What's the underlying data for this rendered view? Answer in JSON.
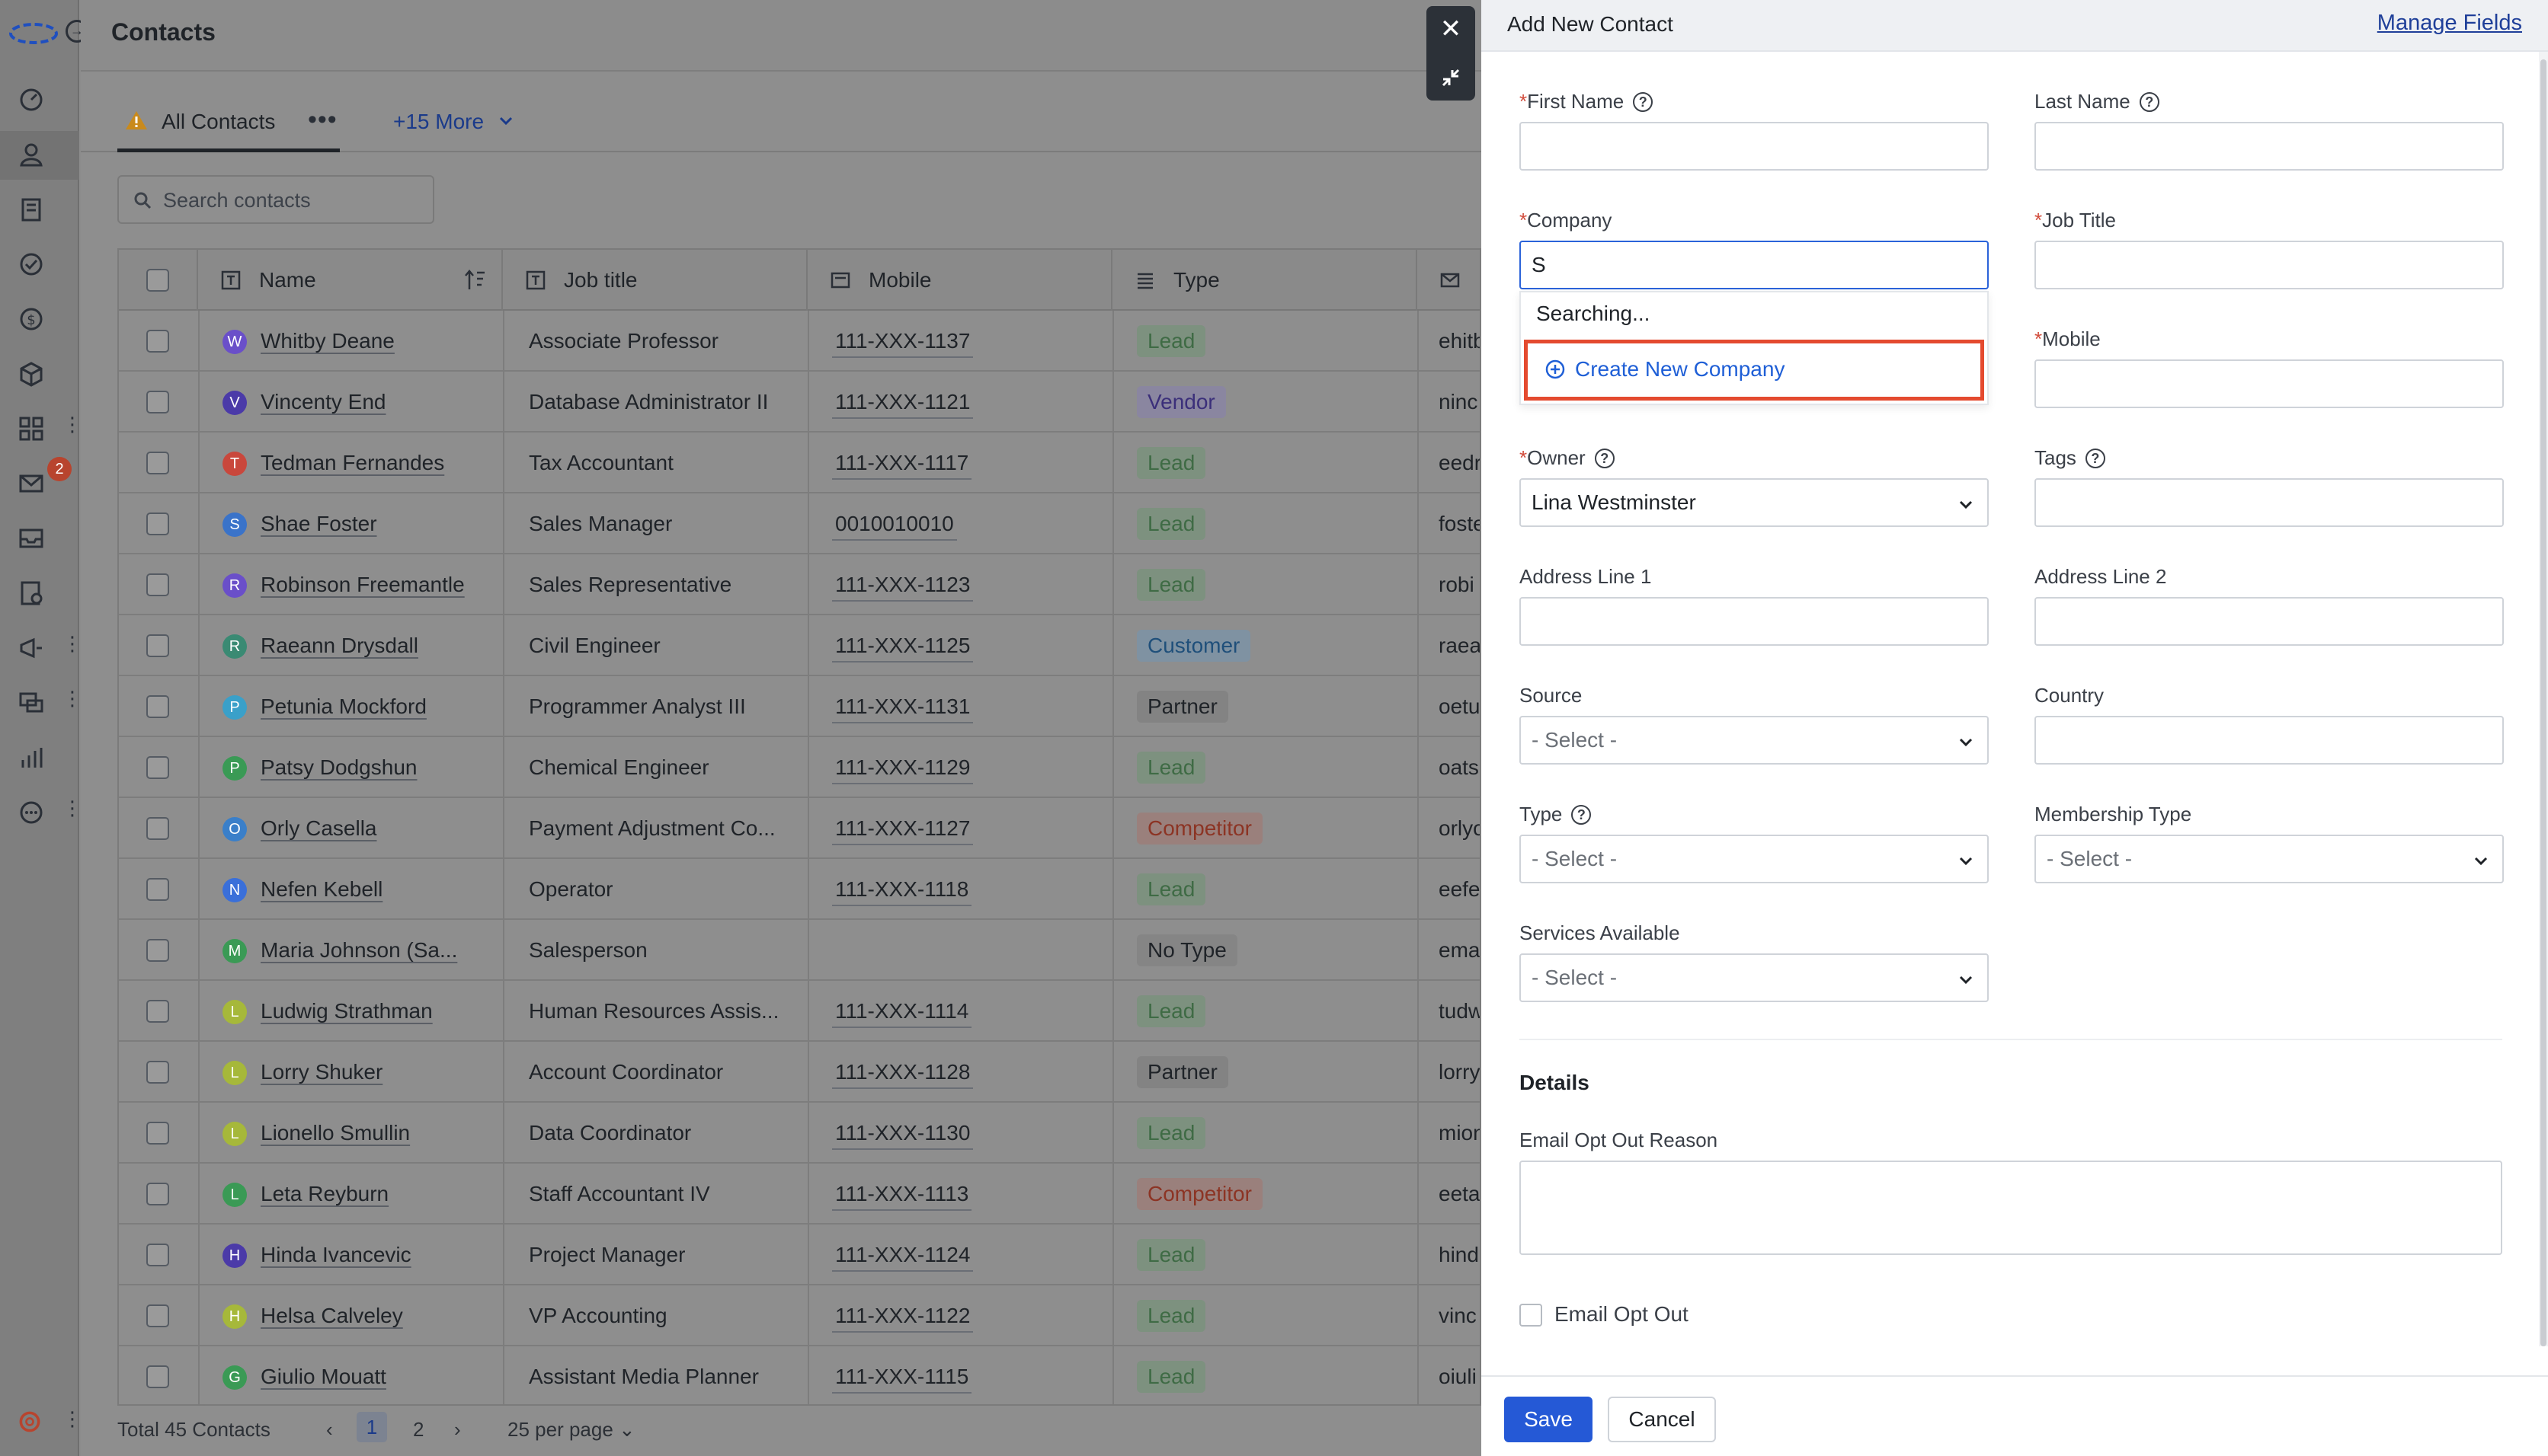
{
  "app": {
    "page_title": "Contacts"
  },
  "rail": {
    "notification_count": "2"
  },
  "tabs": {
    "active_label": "All Contacts",
    "more_menu": "•••",
    "extra_label": "+15 More"
  },
  "search": {
    "placeholder": "Search contacts"
  },
  "table": {
    "columns": [
      "Name",
      "Job title",
      "Mobile",
      "Type",
      "E"
    ],
    "rows": [
      {
        "initial": "W",
        "color": "#6a4fc9",
        "name": "Whitby Deane",
        "job": "Associate Professor",
        "mobile": "111-XXX-1137",
        "type": "Lead",
        "email": "ehitb"
      },
      {
        "initial": "V",
        "color": "#4b3aa8",
        "name": "Vincenty End",
        "job": "Database Administrator II",
        "mobile": "111-XXX-1121",
        "type": "Vendor",
        "email": "ninc"
      },
      {
        "initial": "T",
        "color": "#c9473c",
        "name": "Tedman Fernandes",
        "job": "Tax Accountant",
        "mobile": "111-XXX-1117",
        "type": "Lead",
        "email": "eedr"
      },
      {
        "initial": "S",
        "color": "#3a73c9",
        "name": "Shae Foster",
        "job": "Sales Manager",
        "mobile": "0010010010",
        "type": "Lead",
        "email": "foste"
      },
      {
        "initial": "R",
        "color": "#6a4fc9",
        "name": "Robinson Freemantle",
        "job": "Sales Representative",
        "mobile": "111-XXX-1123",
        "type": "Lead",
        "email": "robi"
      },
      {
        "initial": "R",
        "color": "#3a8a73",
        "name": "Raeann Drysdall",
        "job": "Civil Engineer",
        "mobile": "111-XXX-1125",
        "type": "Customer",
        "email": "raea"
      },
      {
        "initial": "P",
        "color": "#3aa0c9",
        "name": "Petunia Mockford",
        "job": "Programmer Analyst III",
        "mobile": "111-XXX-1131",
        "type": "Partner",
        "email": "oetu"
      },
      {
        "initial": "P",
        "color": "#3a9a55",
        "name": "Patsy Dodgshun",
        "job": "Chemical Engineer",
        "mobile": "111-XXX-1129",
        "type": "Lead",
        "email": "oats"
      },
      {
        "initial": "O",
        "color": "#3a7fc9",
        "name": "Orly Casella",
        "job": "Payment Adjustment Co...",
        "mobile": "111-XXX-1127",
        "type": "Competitor",
        "email": "orlyc"
      },
      {
        "initial": "N",
        "color": "#3a6fd9",
        "name": "Nefen Kebell",
        "job": "Operator",
        "mobile": "111-XXX-1118",
        "type": "Lead",
        "email": "eefe"
      },
      {
        "initial": "M",
        "color": "#3a9a55",
        "name": "Maria Johnson (Sa...",
        "job": "Salesperson",
        "mobile": "",
        "type": "No Type",
        "email": "ema"
      },
      {
        "initial": "L",
        "color": "#a6b83a",
        "name": "Ludwig Strathman",
        "job": "Human Resources Assis...",
        "mobile": "111-XXX-1114",
        "type": "Lead",
        "email": "tudw"
      },
      {
        "initial": "L",
        "color": "#a6b83a",
        "name": "Lorry Shuker",
        "job": "Account Coordinator",
        "mobile": "111-XXX-1128",
        "type": "Partner",
        "email": "lorry"
      },
      {
        "initial": "L",
        "color": "#a6b83a",
        "name": "Lionello Smullin",
        "job": "Data Coordinator",
        "mobile": "111-XXX-1130",
        "type": "Lead",
        "email": "mion"
      },
      {
        "initial": "L",
        "color": "#3a9a55",
        "name": "Leta Reyburn",
        "job": "Staff Accountant IV",
        "mobile": "111-XXX-1113",
        "type": "Competitor",
        "email": "eeta"
      },
      {
        "initial": "H",
        "color": "#4b3aa8",
        "name": "Hinda Ivancevic",
        "job": "Project Manager",
        "mobile": "111-XXX-1124",
        "type": "Lead",
        "email": "hind"
      },
      {
        "initial": "H",
        "color": "#a6b83a",
        "name": "Helsa Calveley",
        "job": "VP Accounting",
        "mobile": "111-XXX-1122",
        "type": "Lead",
        "email": "vinc"
      },
      {
        "initial": "G",
        "color": "#3a9a55",
        "name": "Giulio Mouatt",
        "job": "Assistant Media Planner",
        "mobile": "111-XXX-1115",
        "type": "Lead",
        "email": "oiuli"
      }
    ]
  },
  "footer": {
    "total": "Total 45 Contacts",
    "page_current": "1",
    "page_next": "2",
    "per_page": "25 per page"
  },
  "overlay": {
    "close_glyph": "✕"
  },
  "panel": {
    "title": "Add New Contact",
    "manage_fields": "Manage Fields",
    "fields": {
      "first_name": "First Name",
      "last_name": "Last Name",
      "company": "Company",
      "company_value": "S",
      "job_title": "Job Title",
      "mobile": "Mobile",
      "owner": "Owner",
      "owner_value": "Lina Westminster",
      "tags": "Tags",
      "address1": "Address Line 1",
      "address2": "Address Line 2",
      "source": "Source",
      "source_value": "- Select -",
      "country": "Country",
      "type": "Type",
      "type_value": "- Select -",
      "membership": "Membership Type",
      "membership_value": "- Select -",
      "services": "Services Available",
      "services_value": "- Select -"
    },
    "required_mark": "*",
    "help_mark": "?",
    "company_dropdown": {
      "searching": "Searching...",
      "create_new": "Create New Company"
    },
    "details_heading": "Details",
    "email_opt_out_reason": "Email Opt Out Reason",
    "email_opt_out": "Email Opt Out",
    "save": "Save",
    "cancel": "Cancel"
  },
  "colors": {
    "accent": "#2559d6",
    "highlight": "#e44a2f",
    "link": "#1f5fd6"
  }
}
